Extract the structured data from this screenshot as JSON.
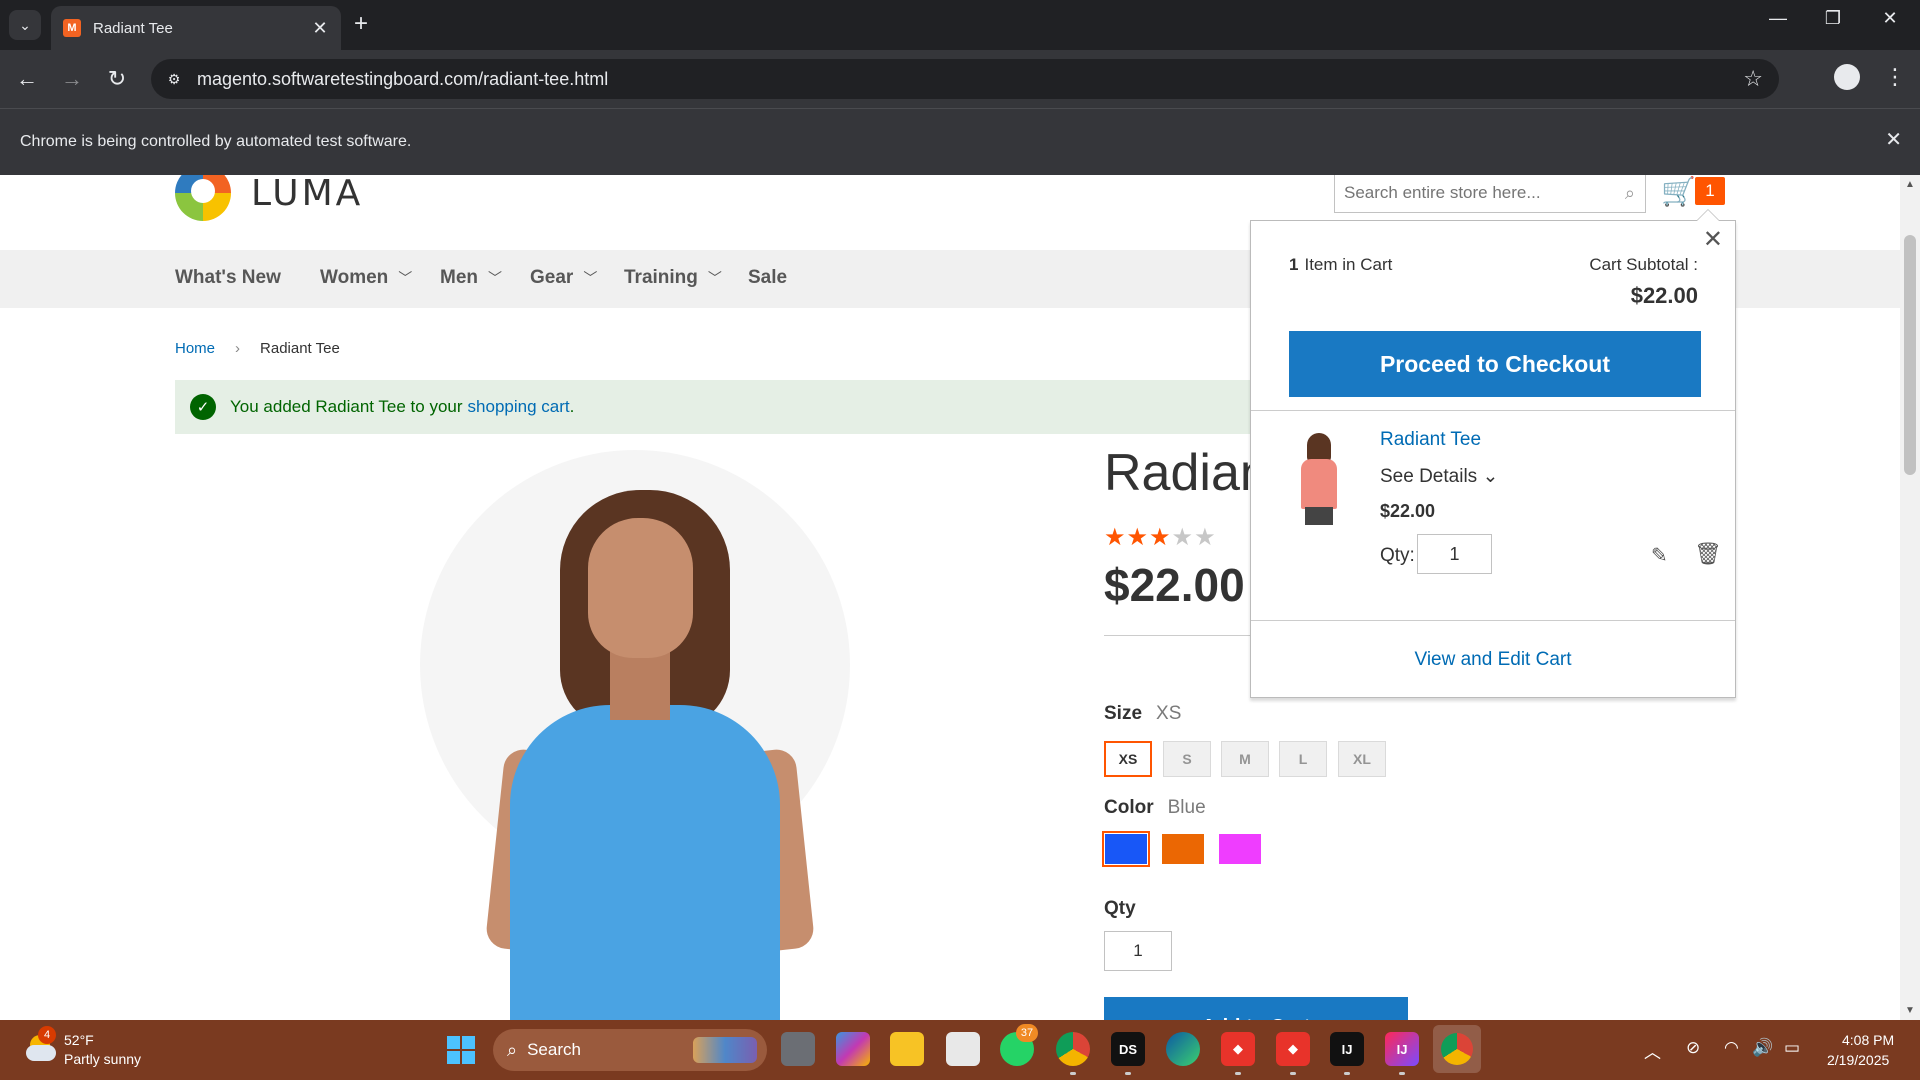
{
  "browser": {
    "tab_title": "Radiant Tee",
    "url": "magento.softwaretestingboard.com/radiant-tee.html",
    "infobar_text": "Chrome is being controlled by automated test software."
  },
  "store": {
    "logo_text": "LUMA",
    "search_placeholder": "Search entire store here...",
    "cart_count": "1",
    "nav": [
      "What's New",
      "Women",
      "Men",
      "Gear",
      "Training",
      "Sale"
    ]
  },
  "breadcrumb": {
    "home": "Home",
    "current": "Radiant Tee"
  },
  "message": {
    "text": "You added Radiant Tee to your",
    "link": "shopping cart",
    "end": "."
  },
  "product": {
    "name": "Radiant Tee",
    "rating_stars": 3,
    "rating_max": 5,
    "price": "$22.00",
    "size_label": "Size",
    "size_selected": "XS",
    "sizes": [
      "XS",
      "S",
      "M",
      "L",
      "XL"
    ],
    "color_label": "Color",
    "color_selected": "Blue",
    "colors": [
      "#1857f7",
      "#eb6703",
      "#ef3dff"
    ],
    "qty_label": "Qty",
    "qty": "1",
    "add_button": "Add to Cart"
  },
  "minicart": {
    "count": "1",
    "count_label": "Item in Cart",
    "subtotal_label": "Cart Subtotal :",
    "subtotal": "$22.00",
    "checkout": "Proceed to Checkout",
    "item_name": "Radiant Tee",
    "see_details": "See Details",
    "item_price": "$22.00",
    "qty_label": "Qty:",
    "qty": "1",
    "view_cart": "View and Edit Cart"
  },
  "taskbar": {
    "weather_badge": "4",
    "temperature": "52°F",
    "weather": "Partly sunny",
    "search": "Search",
    "whatsapp_badge": "37",
    "time": "4:08 PM",
    "date": "2/19/2025"
  },
  "colors": {
    "accent": "#1979c3",
    "cart_badge": "#ff5501",
    "link": "#006bb4"
  }
}
